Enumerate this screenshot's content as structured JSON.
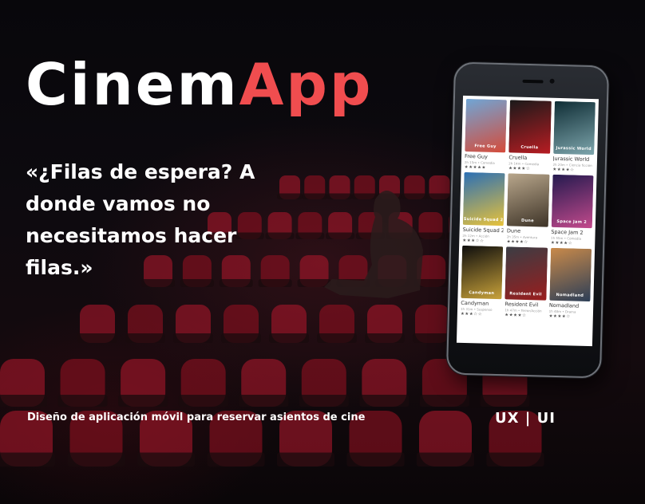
{
  "title": {
    "part1": "Cinem",
    "part2": "App"
  },
  "quote": "«¿Filas de espera? A donde vamos no necesitamos hacer filas.»",
  "subtitle": "Diseño de aplicación móvil para reservar asientos de cine",
  "tag": "UX | UI",
  "colors": {
    "accent": "#f04d4f",
    "background": "#07060a",
    "seat": "#b0162a"
  },
  "movies": [
    {
      "title": "Free Guy",
      "meta": "2h 15m • Comedia",
      "stars": "★★★★★",
      "poster_colors": [
        "#6fa6d6",
        "#d54b3a"
      ]
    },
    {
      "title": "Cruella",
      "meta": "2h 14m • Comedia",
      "stars": "★★★★☆",
      "poster_colors": [
        "#1a1a1a",
        "#b81c22"
      ]
    },
    {
      "title": "Jurassic World",
      "meta": "2h 20m • Ciencia ficción",
      "stars": "★★★★☆",
      "poster_colors": [
        "#0f2d35",
        "#7ea6ad"
      ]
    },
    {
      "title": "Suicide Squad 2",
      "meta": "2h 12m • Acción",
      "stars": "★★★☆☆",
      "poster_colors": [
        "#2b6fb5",
        "#e8c23a"
      ]
    },
    {
      "title": "Dune",
      "meta": "2h 35m • Aventura",
      "stars": "★★★★☆",
      "poster_colors": [
        "#b9a78c",
        "#3d3327"
      ]
    },
    {
      "title": "Space Jam 2",
      "meta": "1h 55m • Comedia",
      "stars": "★★★★☆",
      "poster_colors": [
        "#241a4f",
        "#c34a8c"
      ]
    },
    {
      "title": "Candyman",
      "meta": "1h 31m • Suspenso",
      "stars": "★★★☆☆",
      "poster_colors": [
        "#0d0d0d",
        "#c9a23a"
      ]
    },
    {
      "title": "Resident Evil",
      "meta": "1h 47m • Terror/Acción",
      "stars": "★★★★☆",
      "poster_colors": [
        "#3a3d44",
        "#9a1d1d"
      ]
    },
    {
      "title": "Nomadland",
      "meta": "1h 48m • Drama",
      "stars": "★★★★☆",
      "poster_colors": [
        "#c98a4a",
        "#2c3e57"
      ]
    }
  ]
}
